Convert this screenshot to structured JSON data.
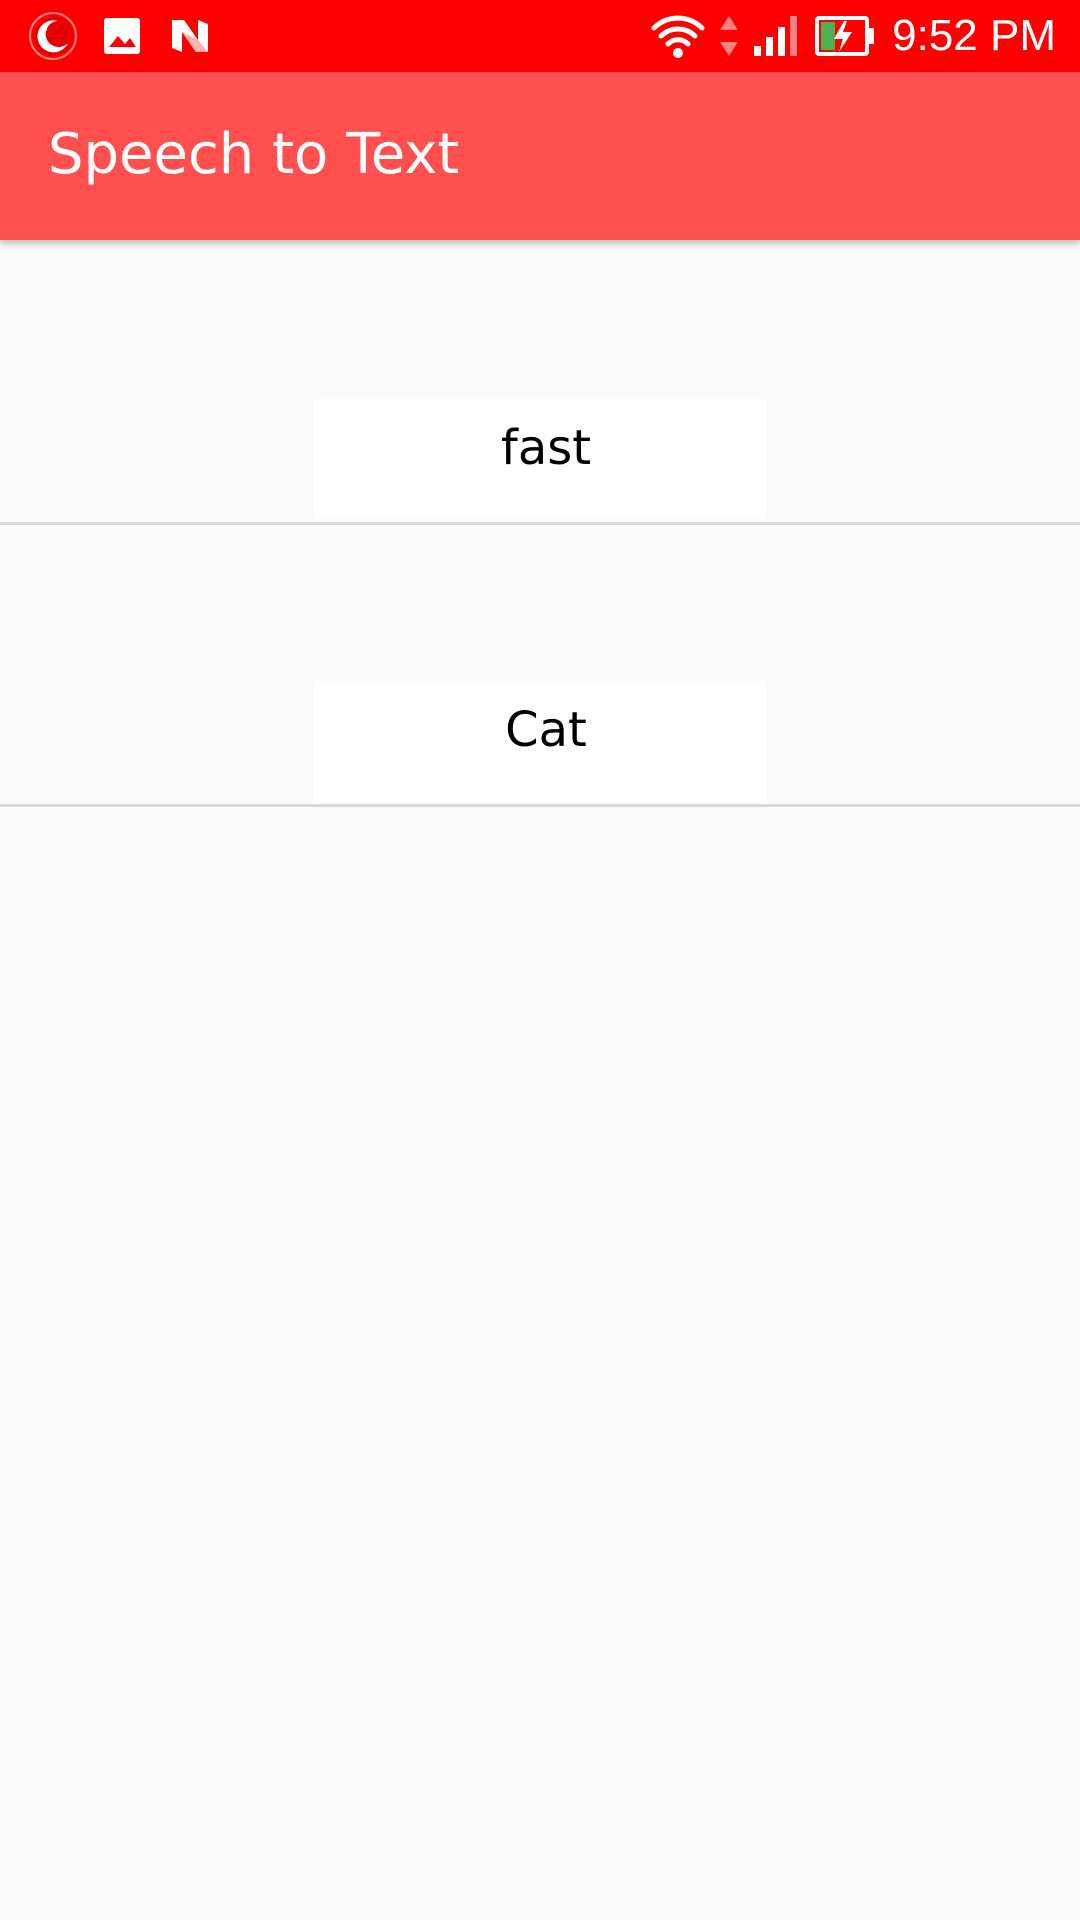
{
  "status_bar": {
    "time": "9:52 PM",
    "left_icons": [
      "night-mode-icon",
      "gallery-icon",
      "nfc-icon"
    ],
    "right_icons": [
      "wifi-icon",
      "data-arrows-icon",
      "cell-signal-icon",
      "battery-charging-icon"
    ],
    "background_color": "#ff0000"
  },
  "app_bar": {
    "title": "Speech to Text",
    "background_color": "#ff4f4f"
  },
  "list": {
    "items": [
      {
        "word": "fast"
      },
      {
        "word": "Cat"
      }
    ]
  }
}
